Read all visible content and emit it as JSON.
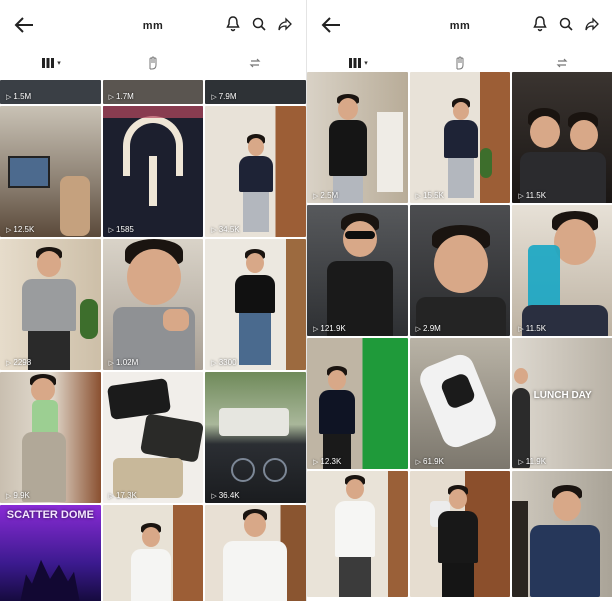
{
  "left": {
    "username": "mm",
    "top_strip": [
      {
        "views": "1.5M"
      },
      {
        "views": "1.7M"
      },
      {
        "views": "7.9M"
      }
    ],
    "tiles": [
      {
        "views": "12.5K",
        "scene": "room"
      },
      {
        "views": "1585",
        "scene": "polo"
      },
      {
        "views": "34.5K",
        "scene": "door-navy"
      },
      {
        "views": "2298",
        "scene": "grey-tee"
      },
      {
        "views": "1.02M",
        "scene": "closeup-tee"
      },
      {
        "views": "3300",
        "scene": "black-polo"
      },
      {
        "views": "9.9K",
        "scene": "holding-can"
      },
      {
        "views": "17.3K",
        "scene": "clothes"
      },
      {
        "views": "36.4K",
        "scene": "car"
      },
      {
        "views": "",
        "scene": "poster",
        "text": "SCATTER DOME"
      },
      {
        "views": "",
        "scene": "white-tee-door"
      },
      {
        "views": "",
        "scene": "white-tee"
      }
    ]
  },
  "right": {
    "username": "mm",
    "tiles": [
      {
        "views": "2.5M",
        "scene": "kitchen-black"
      },
      {
        "views": "15.5K",
        "scene": "door-navy"
      },
      {
        "views": "11.5K",
        "scene": "couple"
      },
      {
        "views": "121.9K",
        "scene": "car-sunglasses"
      },
      {
        "views": "2.9M",
        "scene": "car-selfie"
      },
      {
        "views": "11.5K",
        "scene": "mouthwash"
      },
      {
        "views": "12.3K",
        "scene": "greenscreen"
      },
      {
        "views": "61.9K",
        "scene": "shoe"
      },
      {
        "views": "11.9K",
        "scene": "lunch",
        "text": "LUNCH DAY"
      },
      {
        "views": "",
        "scene": "white-tee-door"
      },
      {
        "views": "",
        "scene": "bag-door"
      },
      {
        "views": "",
        "scene": "sticker-fence"
      }
    ]
  },
  "tabs": {
    "videos": "videos-grid-icon",
    "liked": "hand-icon",
    "reposts": "repost-icon"
  },
  "colors": {
    "accent": "#222222",
    "overlay": "#ffffff"
  }
}
